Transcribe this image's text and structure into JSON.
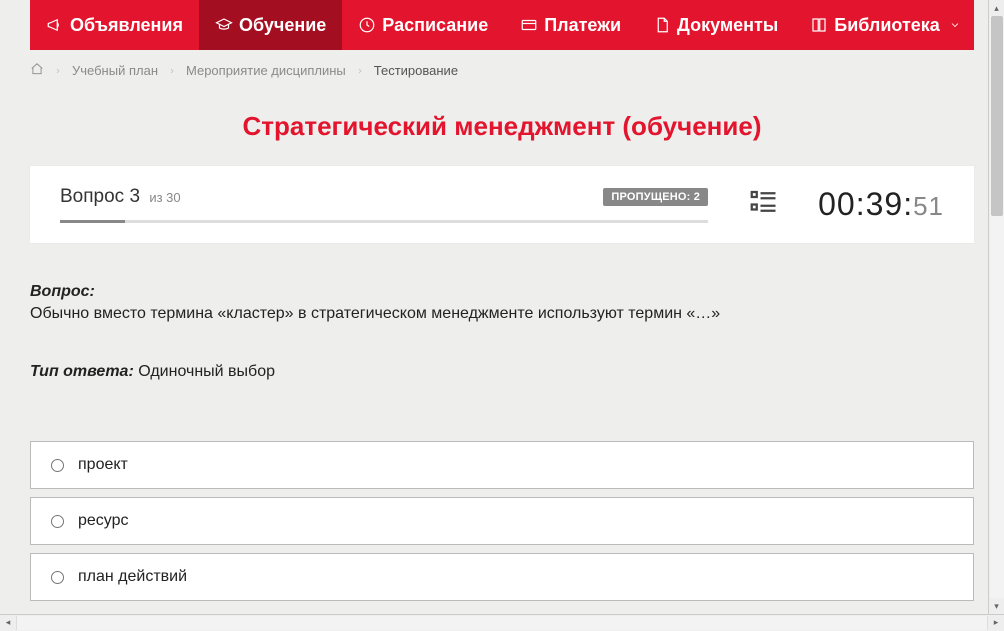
{
  "nav": {
    "items": [
      {
        "label": "Объявления",
        "icon": "megaphone"
      },
      {
        "label": "Обучение",
        "icon": "grad-cap",
        "active": true
      },
      {
        "label": "Расписание",
        "icon": "clock"
      },
      {
        "label": "Платежи",
        "icon": "card"
      },
      {
        "label": "Документы",
        "icon": "doc"
      },
      {
        "label": "Библиотека",
        "icon": "book",
        "hasDropdown": true
      }
    ]
  },
  "breadcrumb": {
    "items": [
      {
        "label": "Учебный план"
      },
      {
        "label": "Мероприятие дисциплины"
      },
      {
        "label": "Тестирование",
        "current": true
      }
    ]
  },
  "title": "Стратегический менеджмент (обучение)",
  "question_bar": {
    "question_word": "Вопрос",
    "current": "3",
    "of_word": "из",
    "total": "30",
    "skipped_label": "ПРОПУЩЕНО: 2",
    "progress_percent": 10
  },
  "timer": {
    "main": "00:39:",
    "seconds": "51"
  },
  "question": {
    "label": "Вопрос:",
    "text": "Обычно вместо термина «кластер» в стратегическом менеджменте используют термин «…»"
  },
  "answer_type": {
    "label": "Тип ответа:",
    "value": "Одиночный выбор"
  },
  "options": [
    {
      "label": "проект"
    },
    {
      "label": "ресурс"
    },
    {
      "label": "план действий"
    }
  ]
}
